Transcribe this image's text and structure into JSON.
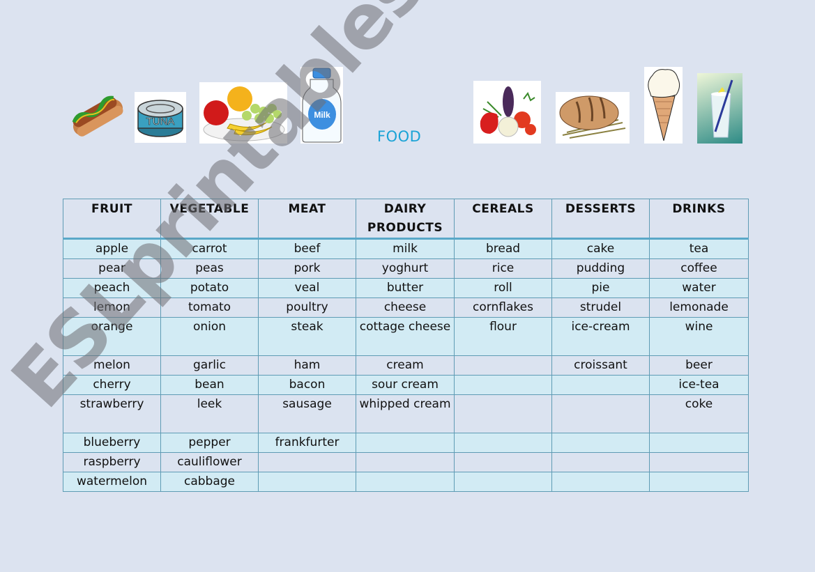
{
  "title": "FOOD",
  "images": {
    "hotdog": "hot-dog",
    "tuna": "TUNA",
    "fruit": "fruit-plate",
    "milk": "Milk",
    "vegetables": "vegetables",
    "bread": "bread",
    "icecream": "ice-cream-cone",
    "drink": "glass-of-water"
  },
  "table": {
    "headers": [
      "FRUIT",
      "VEGETABLE",
      "MEAT",
      "DAIRY PRODUCTS",
      "CEREALS",
      "DESSERTS",
      "DRINKS"
    ],
    "rows": [
      [
        "apple",
        "carrot",
        "beef",
        "milk",
        "bread",
        "cake",
        "tea"
      ],
      [
        "pear",
        "peas",
        "pork",
        "yoghurt",
        "rice",
        "pudding",
        "coffee"
      ],
      [
        "peach",
        "potato",
        "veal",
        "butter",
        "roll",
        "pie",
        "water"
      ],
      [
        "lemon",
        "tomato",
        "poultry",
        "cheese",
        "cornflakes",
        "strudel",
        "lemonade"
      ],
      [
        "orange",
        "onion",
        "steak",
        "cottage cheese",
        "flour",
        "ice-cream",
        "wine"
      ],
      [
        "melon",
        "garlic",
        "ham",
        "cream",
        "",
        "croissant",
        "beer"
      ],
      [
        "cherry",
        "bean",
        "bacon",
        "sour cream",
        "",
        "",
        "ice-tea"
      ],
      [
        "strawberry",
        "leek",
        "sausage",
        "whipped cream",
        "",
        "",
        "coke"
      ],
      [
        "blueberry",
        "pepper",
        "frankfurter",
        "",
        "",
        "",
        ""
      ],
      [
        "raspberry",
        "cauliflower",
        "",
        "",
        "",
        "",
        ""
      ],
      [
        "watermelon",
        "cabbage",
        "",
        "",
        "",
        "",
        ""
      ]
    ]
  },
  "watermark": "ESLprintables.com",
  "colors": {
    "background": "#dce3f0",
    "title": "#1aa3d6",
    "border": "#5e9bb4",
    "row_cyan": "#d2ebf4",
    "row_gray": "#dbe3f0"
  }
}
